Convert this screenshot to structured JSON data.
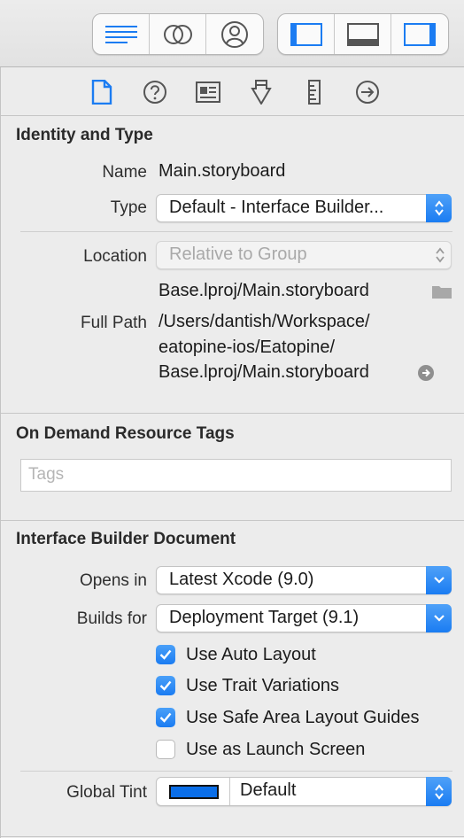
{
  "toolbar": {
    "left_group": [
      "editor-standard-icon",
      "editor-assistant-icon",
      "editor-version-icon"
    ],
    "right_group": [
      "navigator-toggle-icon",
      "debug-area-toggle-icon",
      "utilities-toggle-icon"
    ]
  },
  "inspector_tabs": [
    "file-inspector-icon",
    "quick-help-icon",
    "identity-inspector-icon",
    "attributes-inspector-icon",
    "size-inspector-icon",
    "connections-inspector-icon"
  ],
  "identity": {
    "title": "Identity and Type",
    "name_label": "Name",
    "name_value": "Main.storyboard",
    "type_label": "Type",
    "type_value": "Default - Interface Builder...",
    "location_label": "Location",
    "location_value": "Relative to Group",
    "location_path": "Base.lproj/Main.storyboard",
    "fullpath_label": "Full Path",
    "fullpath_line1": "/Users/dantish/Workspace/",
    "fullpath_line2": "eatopine-ios/Eatopine/",
    "fullpath_line3": "Base.lproj/Main.storyboard"
  },
  "odr": {
    "title": "On Demand Resource Tags",
    "tags_placeholder": "Tags"
  },
  "ibdoc": {
    "title": "Interface Builder Document",
    "opens_label": "Opens in",
    "opens_value": "Latest Xcode (9.0)",
    "builds_label": "Builds for",
    "builds_value": "Deployment Target (9.1)",
    "checkboxes": [
      {
        "label": "Use Auto Layout",
        "checked": true
      },
      {
        "label": "Use Trait Variations",
        "checked": true
      },
      {
        "label": "Use Safe Area Layout Guides",
        "checked": true
      },
      {
        "label": "Use as Launch Screen",
        "checked": false
      }
    ],
    "tint_label": "Global Tint",
    "tint_value": "Default",
    "tint_color": "#0a6ee8"
  },
  "colors": {
    "accent": "#1a7cf2",
    "toolbar_icon": "#1b7cf2",
    "inactive_icon": "#555555"
  }
}
